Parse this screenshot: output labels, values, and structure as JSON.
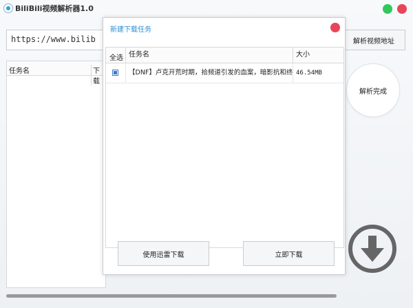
{
  "app": {
    "title": "BiliBili视频解析器1.0"
  },
  "url_bar": {
    "value": "https://www.bilib",
    "parse_label": "解析视频地址"
  },
  "task_table": {
    "headers": [
      "任务名",
      "下载"
    ]
  },
  "status": {
    "done_label": "解析完成"
  },
  "dialog": {
    "title": "新建下载任务",
    "headers": {
      "select": "全选",
      "name": "任务名",
      "size": "大小"
    },
    "rows": [
      {
        "name": "【DNF】卢克开荒时期，拾频道引发的血案，暗影抗和终结",
        "size": "46.54MB",
        "checked": true
      }
    ],
    "buttons": {
      "thunder": "使用迅雷下载",
      "now": "立即下载"
    }
  },
  "icons": {
    "download": "download-circle-icon",
    "close": "close-icon",
    "minimize": "minimize-icon"
  },
  "colors": {
    "accent": "#2a8fd6",
    "close": "#e8455a",
    "minimize": "#2ec95a",
    "download_icon": "#666666"
  }
}
